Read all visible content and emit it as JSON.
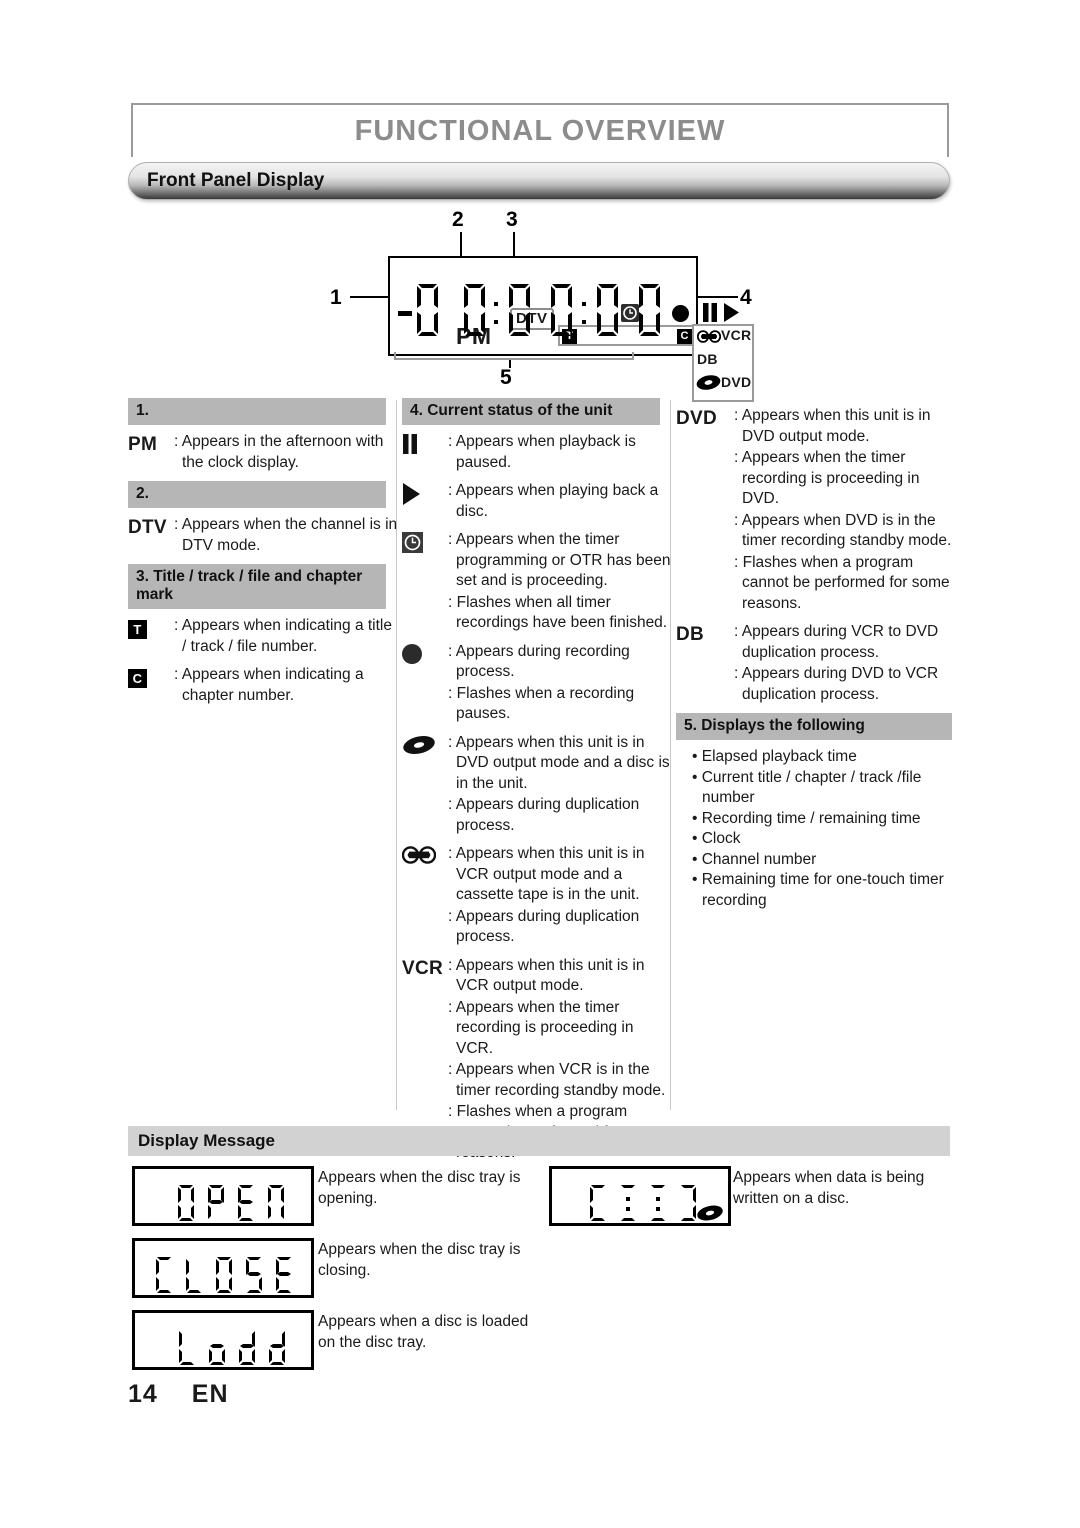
{
  "page": {
    "chapter_title": "FUNCTIONAL OVERVIEW",
    "section_title": "Front Panel Display",
    "footer_page": "14",
    "footer_lang": "EN"
  },
  "diagram": {
    "callouts": [
      "1",
      "2",
      "3",
      "4",
      "5"
    ],
    "lcd": {
      "pm": "PM",
      "dtv": "DTV",
      "title_chip": "T",
      "chapter_chip": "C",
      "vcr": "VCR",
      "db": "DB",
      "dvd": "DVD",
      "digits": "-88:88:88",
      "icons": [
        "clock-icon",
        "record-dot-icon",
        "pause-icon",
        "play-icon",
        "cassette-tape-icon",
        "disc-icon"
      ]
    }
  },
  "columns": {
    "col1": {
      "sections": [
        {
          "header": "1.",
          "entries": [
            {
              "icon_label": "PM",
              "lines": [
                ": Appears in the afternoon with the clock display."
              ]
            }
          ]
        },
        {
          "header": "2.",
          "entries": [
            {
              "icon_label": "DTV",
              "lines": [
                ": Appears when the channel is in DTV mode."
              ]
            }
          ]
        },
        {
          "header": "3. Title / track / file and chapter mark",
          "entries": [
            {
              "icon_label": "T",
              "lines": [
                ": Appears when indicating a title / track / file number."
              ]
            },
            {
              "icon_label": "C",
              "lines": [
                ": Appears when indicating a chapter number."
              ]
            }
          ]
        }
      ]
    },
    "col2": {
      "header": "4. Current status of the unit",
      "entries": [
        {
          "icon_label": "pause-icon",
          "lines": [
            ": Appears when playback is paused."
          ]
        },
        {
          "icon_label": "play-icon",
          "lines": [
            ": Appears when playing back a disc."
          ]
        },
        {
          "icon_label": "clock-icon",
          "lines": [
            ": Appears when the timer programming or OTR has been set and is proceeding.",
            ": Flashes when all timer recordings have been finished."
          ]
        },
        {
          "icon_label": "record-dot-icon",
          "lines": [
            ": Appears during recording process.",
            ": Flashes when a recording pauses."
          ]
        },
        {
          "icon_label": "disc-icon",
          "lines": [
            ": Appears when this unit is in DVD output mode and a disc is in the unit.",
            ": Appears during duplication process."
          ]
        },
        {
          "icon_label": "cassette-tape-icon",
          "lines": [
            ": Appears when this unit is in VCR output mode and a cassette tape is in the unit.",
            ": Appears during duplication process."
          ]
        },
        {
          "icon_label": "VCR",
          "lines": [
            ": Appears when this unit is in VCR output mode.",
            ": Appears when the timer recording is proceeding in VCR.",
            ": Appears when VCR is in the timer recording standby mode.",
            ": Flashes when a program cannot be performed for some reasons."
          ]
        }
      ]
    },
    "col3": {
      "entries": [
        {
          "icon_label": "DVD",
          "lines": [
            ": Appears when this unit is in DVD output mode.",
            ": Appears when the timer recording is proceeding in DVD.",
            ": Appears when DVD is in the timer recording standby mode.",
            ": Flashes when a program cannot be performed for some reasons."
          ]
        },
        {
          "icon_label": "DB",
          "lines": [
            ": Appears during VCR to DVD duplication process.",
            ": Appears during DVD to VCR duplication process."
          ]
        }
      ],
      "header5": "5. Displays the following",
      "bullets": [
        "• Elapsed playback time",
        "• Current title / chapter / track /file number",
        "• Recording time / remaining time",
        "• Clock",
        "• Channel number",
        "• Remaining time for one-touch timer recording"
      ]
    }
  },
  "display_message": {
    "header": "Display Message",
    "items": [
      {
        "lcd_text": "OPEN",
        "description": "Appears when the disc tray is opening."
      },
      {
        "lcd_text": "CLOSE",
        "description": "Appears when the disc tray is closing."
      },
      {
        "lcd_text": "Load",
        "description": "Appears when a disc is loaded on the disc tray."
      },
      {
        "lcd_text": "----",
        "description": "Appears when data is being written on a disc."
      }
    ]
  }
}
